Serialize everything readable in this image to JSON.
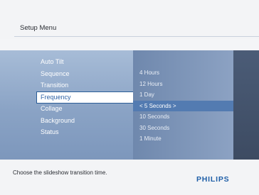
{
  "header": {
    "title": "Setup Menu"
  },
  "menu": {
    "items": [
      "Auto Tilt",
      "Sequence",
      "Transition",
      "Frequency",
      "Collage",
      "Background",
      "Status"
    ],
    "selected_index": 3
  },
  "options": {
    "items": [
      "4 Hours",
      "12 Hours",
      "1 Day",
      "< 5 Seconds >",
      "10 Seconds",
      "30 Seconds",
      "1 Minute"
    ],
    "active_index": 3
  },
  "footer": {
    "help_text": "Choose the slideshow transition time.",
    "brand": "PHILIPS"
  },
  "colors": {
    "brand_blue": "#1f5fa8",
    "selection_blue": "#537bb1"
  }
}
